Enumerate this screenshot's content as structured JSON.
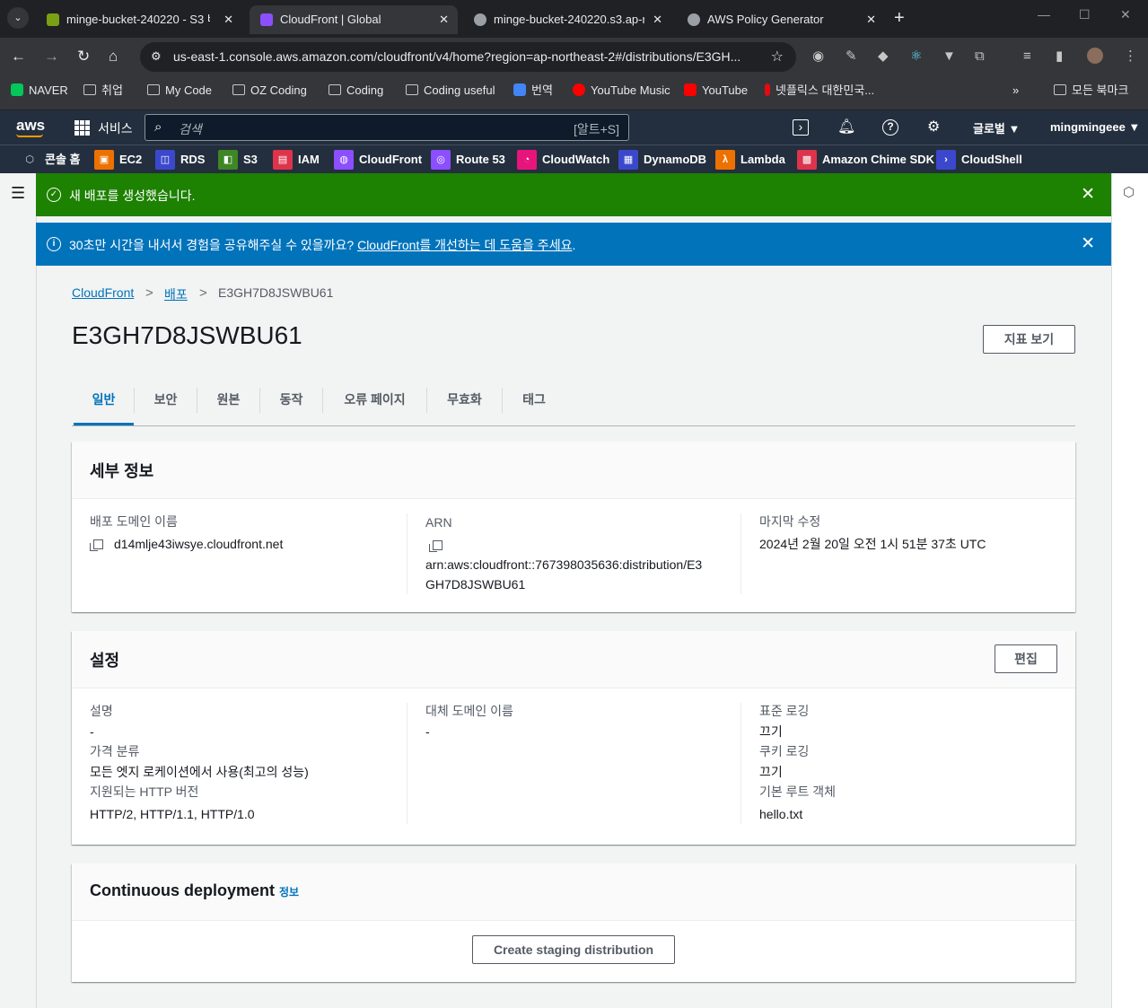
{
  "browser": {
    "tabs": [
      {
        "title": "minge-bucket-240220 - S3 버킷",
        "color": "#7aa116"
      },
      {
        "title": "CloudFront | Global",
        "color": "#8c4fff"
      },
      {
        "title": "minge-bucket-240220.s3.ap-no",
        "color": "#9aa0a6"
      },
      {
        "title": "AWS Policy Generator",
        "color": "#9aa0a6"
      }
    ],
    "url": "us-east-1.console.aws.amazon.com/cloudfront/v4/home?region=ap-northeast-2#/distributions/E3GH...",
    "bookmarks": [
      "NAVER",
      "취업",
      "My Code",
      "OZ Coding",
      "Coding",
      "Coding useful",
      "번역",
      "YouTube Music",
      "YouTube",
      "넷플릭스 대한민국...",
      "모든 북마크"
    ]
  },
  "aws": {
    "logo": "aws",
    "services_label": "서비스",
    "search_placeholder": "검색",
    "search_shortcut": "[알트+S]",
    "region": "글로벌 ▼",
    "user": "mingmingeee ▼",
    "favorites": [
      "콘솔 홈",
      "EC2",
      "RDS",
      "S3",
      "IAM",
      "CloudFront",
      "Route 53",
      "CloudWatch",
      "DynamoDB",
      "Lambda",
      "Amazon Chime SDK",
      "CloudShell"
    ]
  },
  "flash_success": {
    "text": "새 배포를 생성했습니다.",
    "color": "#1d8102"
  },
  "flash_info": {
    "text_before": "30초만 시간을 내서서 경험을 공유해주실 수 있을까요? ",
    "link": "CloudFront를 개선하는 데 도움을 주세요",
    "text_after": ".",
    "color": "#0073bb"
  },
  "breadcrumb": {
    "root": "CloudFront",
    "mid": "배포",
    "current": "E3GH7D8JSWBU61"
  },
  "page_title": "E3GH7D8JSWBU61",
  "metrics_button": "지표 보기",
  "tabs": [
    "일반",
    "보안",
    "원본",
    "동작",
    "오류 페이지",
    "무효화",
    "태그"
  ],
  "details": {
    "title": "세부 정보",
    "domain_label": "배포 도메인 이름",
    "domain_value": "d14mlje43iwsye.cloudfront.net",
    "arn_label": "ARN",
    "arn_line1": "arn:aws:cloudfront::767398035636:distribution/E3",
    "arn_line2": "GH7D8JSWBU61",
    "modified_label": "마지막 수정",
    "modified_value": "2024년 2월 20일 오전 1시 51분 37초 UTC"
  },
  "settings": {
    "title": "설정",
    "edit_button": "편집",
    "desc_label": "설명",
    "desc_value": "-",
    "price_label": "가격 분류",
    "price_value": "모든 엣지 로케이션에서 사용(최고의 성능)",
    "http_label": "지원되는 HTTP 버전",
    "http_value": "HTTP/2, HTTP/1.1, HTTP/1.0",
    "alt_domain_label": "대체 도메인 이름",
    "alt_domain_value": "-",
    "std_log_label": "표준 로깅",
    "std_log_value": "끄기",
    "cookie_log_label": "쿠키 로깅",
    "cookie_log_value": "끄기",
    "root_obj_label": "기본 루트 객체",
    "root_obj_value": "hello.txt"
  },
  "continuous": {
    "title": "Continuous deployment",
    "info": "정보",
    "button": "Create staging distribution"
  }
}
